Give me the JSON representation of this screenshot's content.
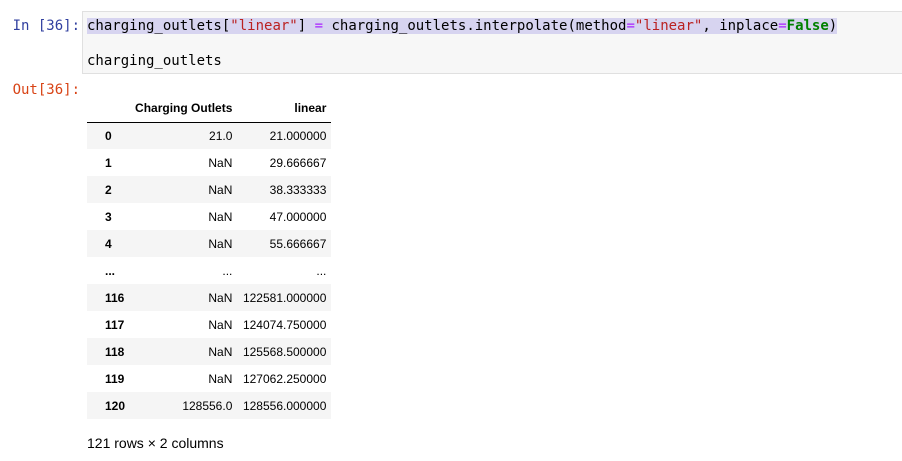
{
  "cell": {
    "in_prompt": "In [36]:",
    "out_prompt": "Out[36]:",
    "code": {
      "line1": {
        "t1": "charging_outlets[",
        "t2": "\"linear\"",
        "t3": "] ",
        "t4": "=",
        "t5": " charging_outlets.interpolate(method",
        "t6": "=",
        "t7": "\"linear\"",
        "t8": ", inplace",
        "t9": "=",
        "t10": "False",
        "t11": ")"
      },
      "line2": "charging_outlets"
    }
  },
  "dataframe": {
    "columns": [
      "",
      "Charging Outlets",
      "linear"
    ],
    "rows": [
      {
        "index": "0",
        "charging_outlets": "21.0",
        "linear": "21.000000"
      },
      {
        "index": "1",
        "charging_outlets": "NaN",
        "linear": "29.666667"
      },
      {
        "index": "2",
        "charging_outlets": "NaN",
        "linear": "38.333333"
      },
      {
        "index": "3",
        "charging_outlets": "NaN",
        "linear": "47.000000"
      },
      {
        "index": "4",
        "charging_outlets": "NaN",
        "linear": "55.666667"
      },
      {
        "index": "...",
        "charging_outlets": "...",
        "linear": "..."
      },
      {
        "index": "116",
        "charging_outlets": "NaN",
        "linear": "122581.000000"
      },
      {
        "index": "117",
        "charging_outlets": "NaN",
        "linear": "124074.750000"
      },
      {
        "index": "118",
        "charging_outlets": "NaN",
        "linear": "125568.500000"
      },
      {
        "index": "119",
        "charging_outlets": "NaN",
        "linear": "127062.250000"
      },
      {
        "index": "120",
        "charging_outlets": "128556.0",
        "linear": "128556.000000"
      }
    ],
    "shape_text": "121 rows × 2 columns"
  },
  "colors": {
    "in_prompt": "#303f9f",
    "out_prompt": "#d84315",
    "string": "#ba2121",
    "operator": "#aa22ff",
    "keyword": "#008000",
    "selection": "#d7d4f0",
    "input_bg": "#f7f7f7",
    "row_stripe": "#f5f5f5"
  }
}
